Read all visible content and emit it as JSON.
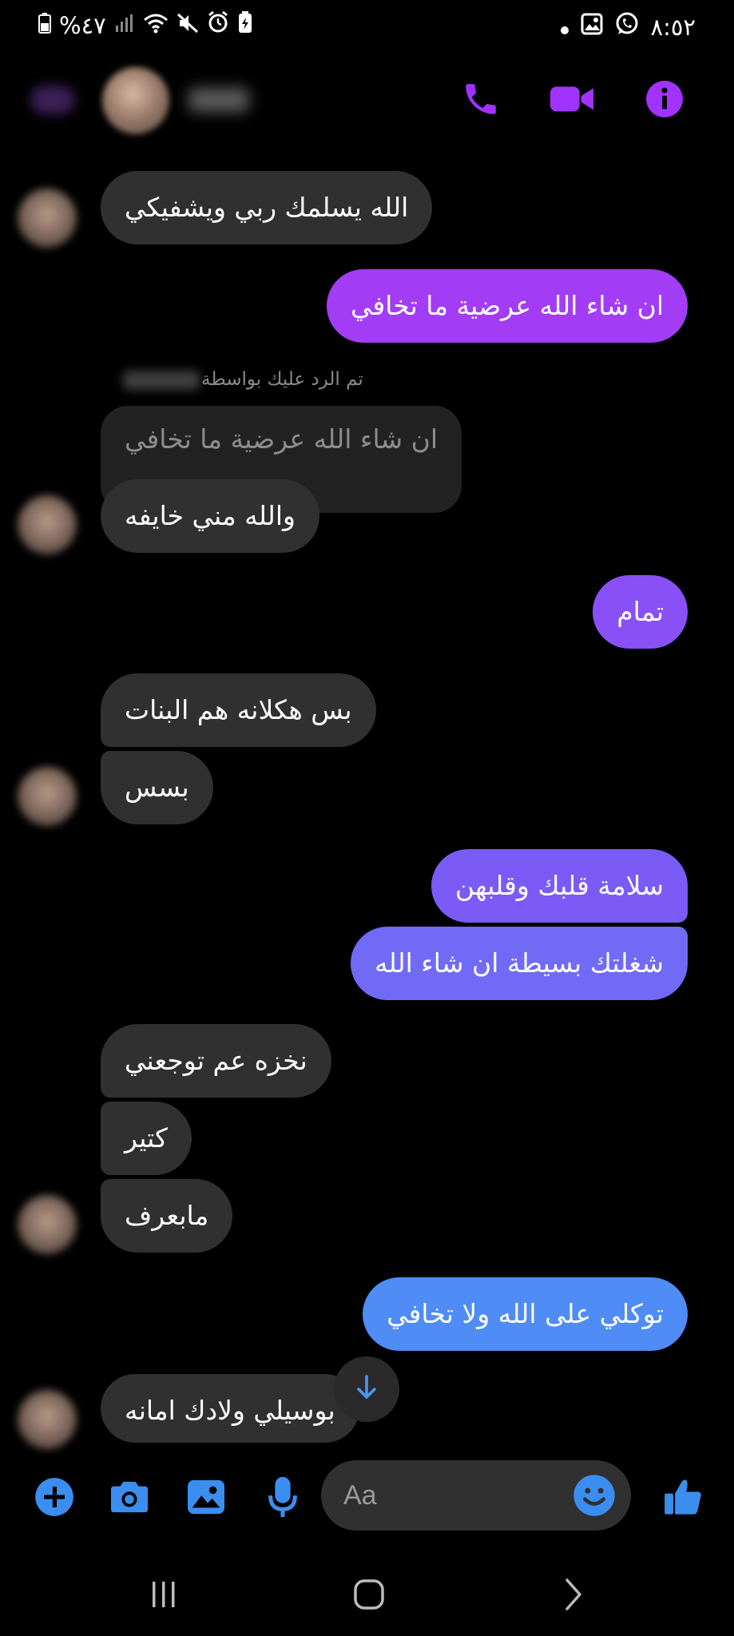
{
  "status_bar": {
    "battery_percent": "%٤٧",
    "time": "٨:٥٢"
  },
  "composer": {
    "placeholder": "Aa"
  },
  "messages": [
    {
      "text": "الله يسلمك ربي ويشفيكي"
    },
    {
      "text": "ان شاء الله عرضية ما تخافي"
    },
    {
      "reply_label": "تم الرد عليك بواسطة",
      "quoted": "ان شاء الله عرضية ما تخافي",
      "text": "والله مني خايفه"
    },
    {
      "text": "تمام"
    },
    {
      "text": "بس هكلانه هم البنات"
    },
    {
      "text": "بسس"
    },
    {
      "text": "سلامة قلبك وقلبهن"
    },
    {
      "text": "شغلتك بسيطة ان شاء الله"
    },
    {
      "text": "نخزه عم توجعني"
    },
    {
      "text": "كتير"
    },
    {
      "text": "مابعرف"
    },
    {
      "text": "توكلي على الله ولا تخافي"
    },
    {
      "text": "بوسيلي ولادك امانه"
    }
  ],
  "colors": {
    "accent_purple": "#a033ff",
    "outgoing_gradient": [
      "#a23df5",
      "#7b5cf6",
      "#4f8cf5"
    ],
    "composer_blue": "#3b8ef0",
    "incoming_bubble": "#303030"
  },
  "icons": [
    "phone-icon",
    "video-icon",
    "info-icon",
    "plus-icon",
    "camera-icon",
    "image-icon",
    "mic-icon",
    "emoji-icon",
    "thumbs-up-icon",
    "arrow-down-icon"
  ]
}
